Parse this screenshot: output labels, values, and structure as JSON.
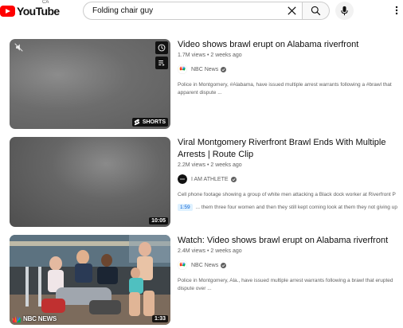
{
  "header": {
    "logo_text": "YouTube",
    "country_code": "CA",
    "search_value": "Folding chair guy",
    "accent_color": "#ff0000"
  },
  "results": [
    {
      "title": "Video shows brawl erupt on Alabama riverfront",
      "views": "1.7M views",
      "age": "2 weeks ago",
      "channel": "NBC News",
      "verified": true,
      "description": "Police in Montgomery, #Alabama, have issued multiple arrest warrants following a #brawl that apparent dispute ...",
      "badge": "SHORTS",
      "icons": [
        "mute-icon",
        "clock-icon",
        "queue-icon"
      ]
    },
    {
      "title": "Viral Montgomery Riverfront Brawl Ends With Multiple Arrests | Route Clip",
      "views": "2.2M views",
      "age": "2 weeks ago",
      "channel": "I AM ATHLETE",
      "verified": true,
      "description": "Cell phone footage showing a group of white men attacking a Black dock worker at Riverfront P",
      "chapter_time": "1:59",
      "chapter_text": "... them three four women and then they still kept coming look at them they not giving up",
      "duration": "10:05"
    },
    {
      "title": "Watch: Video shows brawl erupt on Alabama riverfront",
      "views": "2.4M views",
      "age": "2 weeks ago",
      "channel": "NBC News",
      "verified": true,
      "description": "Police in Montgomery, Ala., have issued multiple arrest warrants following a brawl that erupted dispute over ...",
      "duration": "1:33",
      "watermark": "NBC NEWS"
    }
  ]
}
